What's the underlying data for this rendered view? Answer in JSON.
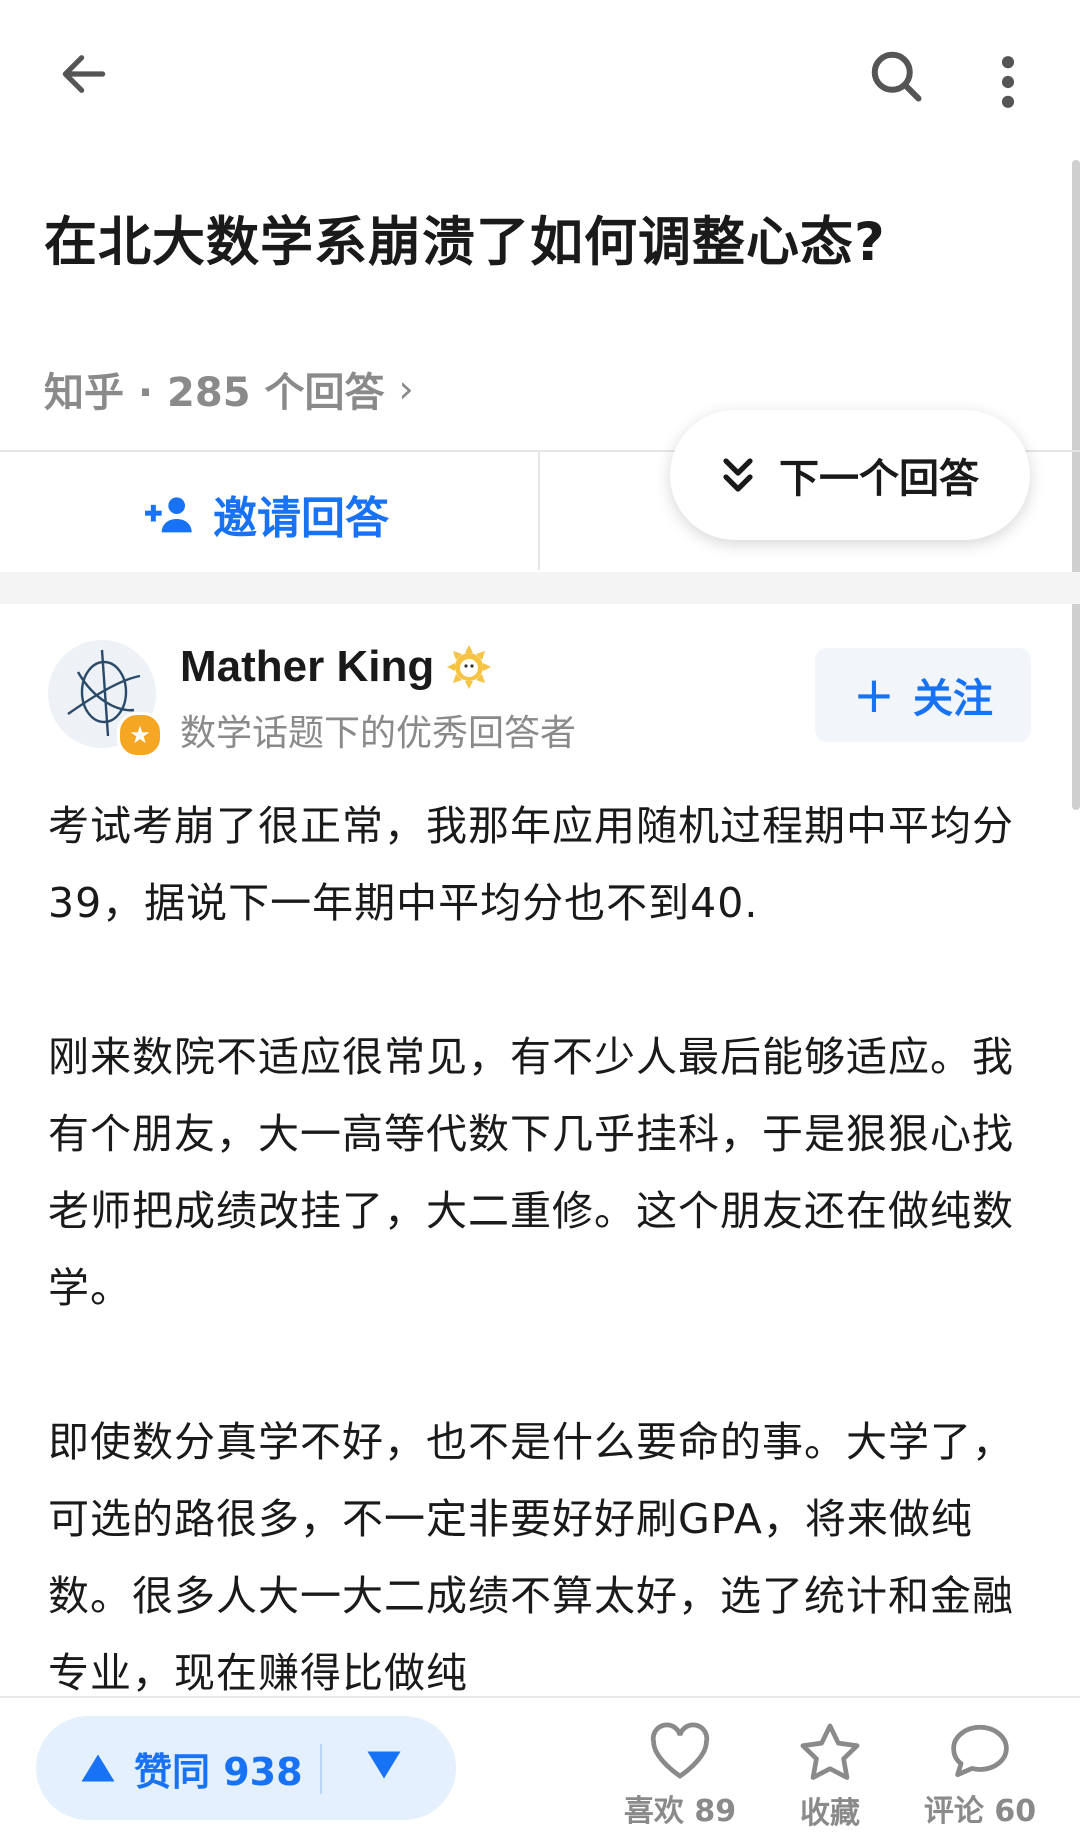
{
  "topbar": {
    "back_icon": "arrow-left-icon",
    "search_icon": "search-icon",
    "more_icon": "more-vertical-icon"
  },
  "question": {
    "title": "在北大数学系崩溃了如何调整心态?",
    "meta": "知乎 · 285 个回答",
    "meta_chevron": "›"
  },
  "actions": {
    "invite_label": "邀请回答",
    "next_answer_label": "下一个回答"
  },
  "author": {
    "name": "Mather King",
    "description": "数学话题下的优秀回答者",
    "follow_label": "关注",
    "follow_plus": "+"
  },
  "answer": {
    "paragraphs": [
      "考试考崩了很正常，我那年应用随机过程期中平均分39，据说下一年期中平均分也不到40.",
      "刚来数院不适应很常见，有不少人最后能够适应。我有个朋友，大一高等代数下几乎挂科，于是狠狠心找老师把成绩改挂了，大二重修。这个朋友还在做纯数学。",
      "即使数分真学不好，也不是什么要命的事。大学了，可选的路很多，不一定非要好好刷GPA，将来做纯数。很多人大一大二成绩不算太好，选了统计和金融专业，现在赚得比做纯"
    ]
  },
  "bottombar": {
    "upvote_label": "赞同 938",
    "like_label": "喜欢 89",
    "favorite_label": "收藏",
    "comment_label": "评论 60"
  },
  "colors": {
    "accent": "#1772f6",
    "muted": "#8a8a8a",
    "vote_bg": "#e4f0fd"
  }
}
